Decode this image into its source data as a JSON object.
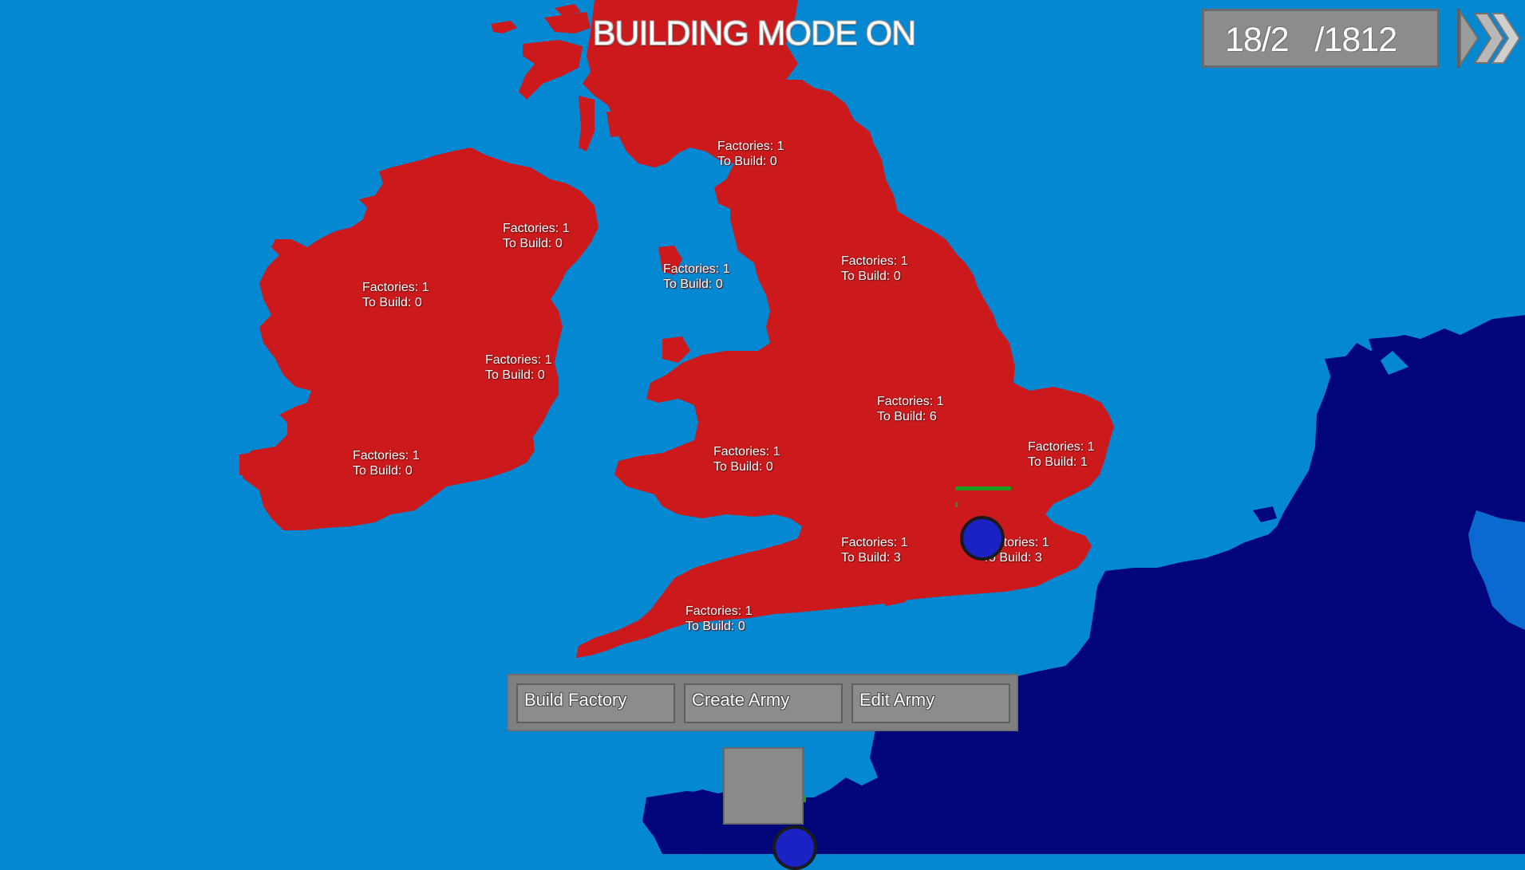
{
  "hud": {
    "mode_banner": "BUILDING MODE ON",
    "date": "18/2   /1812",
    "fast_forward_icon": "fast-forward-icon"
  },
  "colors": {
    "sea": "#0488d2",
    "player_territory": "#cc1a1c",
    "enemy_territory": "#00057a",
    "enemy_highlight": "#0a6ad0",
    "army": "#1b22c4",
    "health": "#1c9a1c"
  },
  "regions": [
    {
      "factories": "Factories: 1",
      "to_build": "To Build: 0"
    },
    {
      "factories": "Factories: 1",
      "to_build": "To Build: 0"
    },
    {
      "factories": "Factories: 1",
      "to_build": "To Build: 0"
    },
    {
      "factories": "Factories: 1",
      "to_build": "To Build: 0"
    },
    {
      "factories": "Factories: 1",
      "to_build": "To Build: 0"
    },
    {
      "factories": "Factories: 1",
      "to_build": "To Build: 0"
    },
    {
      "factories": "Factories: 1",
      "to_build": "To Build: 0"
    },
    {
      "factories": "Factories: 1",
      "to_build": "To Build: 6"
    },
    {
      "factories": "Factories: 1",
      "to_build": "To Build: 1"
    },
    {
      "factories": "Factories: 1",
      "to_build": "To Build: 0"
    },
    {
      "factories": "Factories: 1",
      "to_build": "To Build: 3"
    },
    {
      "factories": "Factories: 1",
      "to_build": "To Build: 3"
    },
    {
      "factories": "Factories: 1",
      "to_build": "To Build: 0"
    }
  ],
  "actions": {
    "build_factory": "Build Factory",
    "create_army": "Create Army",
    "edit_army": "Edit Army"
  }
}
